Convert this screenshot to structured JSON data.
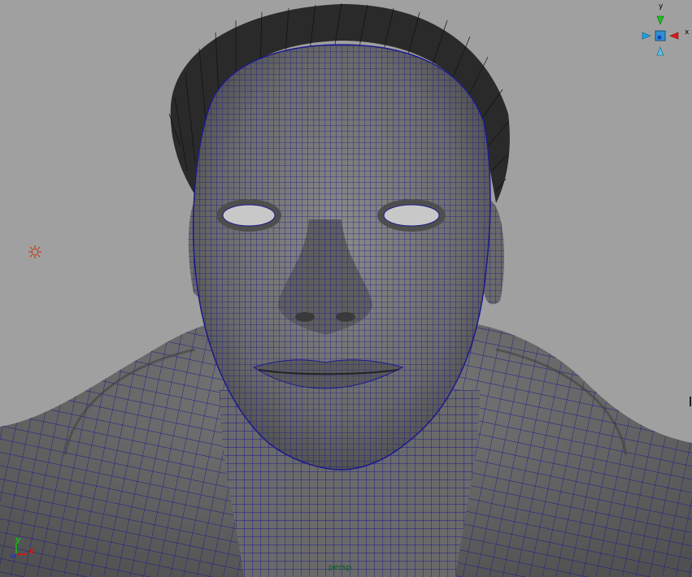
{
  "viewport": {
    "camera_name": "persp",
    "background": "#a0a0a0",
    "wire_color": "#1a1a8c",
    "shade_color": "#6e6e6e"
  },
  "view_cube": {
    "y_label": "y",
    "x_label": "x",
    "x_color": "#e01818",
    "y_color": "#20c020",
    "z_color": "#20a0e0"
  },
  "axis_indicator": {
    "y_label": "y",
    "x_label": "x",
    "z_label": "z"
  },
  "scene": {
    "light_icon": "point-light-icon",
    "object": "head-mesh-wireframe-on-shaded"
  }
}
